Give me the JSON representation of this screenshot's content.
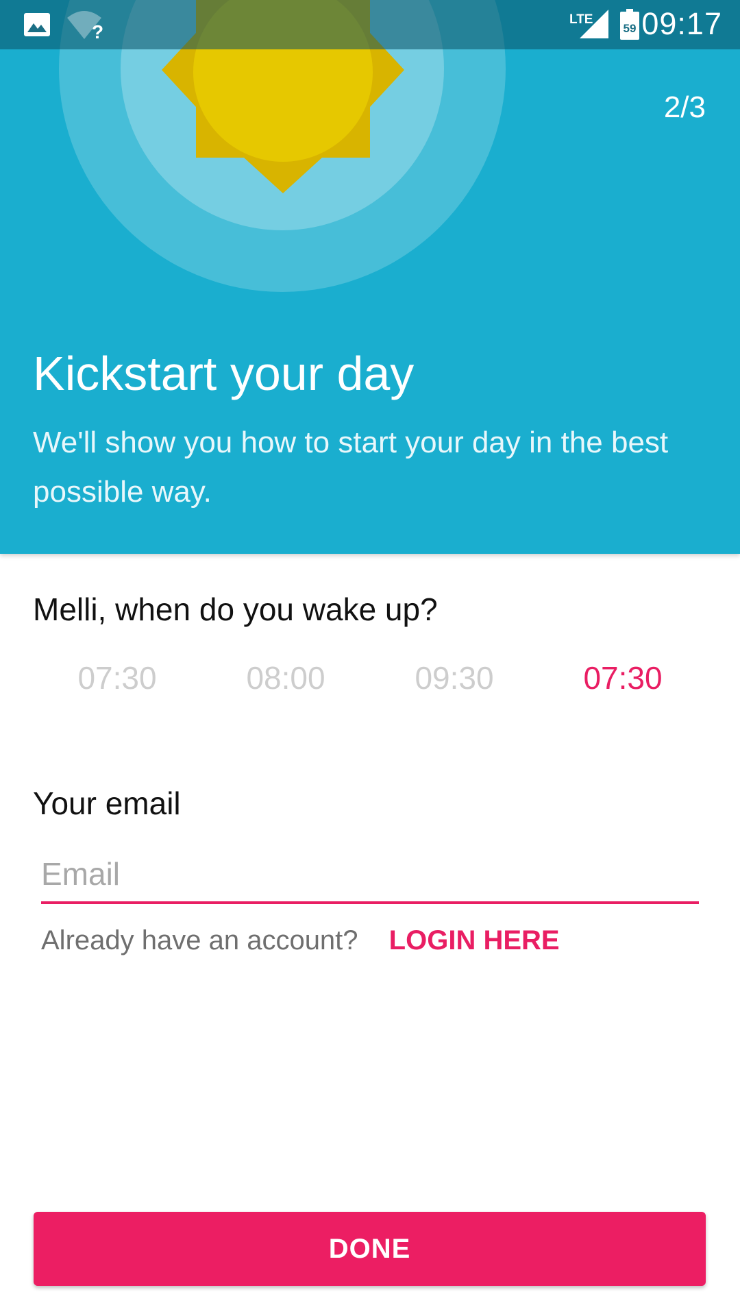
{
  "status_bar": {
    "time": "09:17",
    "network_type": "LTE",
    "battery_level": "59",
    "icons": [
      "image-icon",
      "wifi-unknown-icon",
      "lte-signal-icon",
      "battery-icon"
    ]
  },
  "header": {
    "page_counter": "2/3",
    "title": "Kickstart your day",
    "subtitle": "We'll show you how to start your day in the best possible way.",
    "background_color": "#1aaecf",
    "illustration": "sun-icon"
  },
  "wake_up": {
    "question": "Melli, when do you wake up?",
    "options": [
      "07:30",
      "08:00",
      "09:30",
      "07:30"
    ],
    "selected_index": 3
  },
  "email": {
    "label": "Your email",
    "value": "",
    "placeholder": "Email"
  },
  "account": {
    "prompt": "Already have an account?",
    "login_label": "LOGIN HERE"
  },
  "done_button": {
    "label": "DONE"
  },
  "colors": {
    "accent": "#e91e63",
    "header": "#1aaecf",
    "sun": "#e6c800"
  }
}
